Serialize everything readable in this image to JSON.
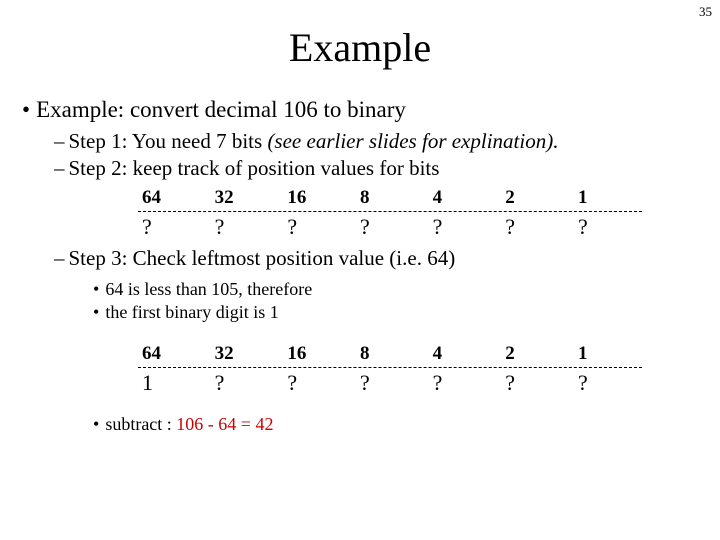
{
  "page_number": "35",
  "title": "Example",
  "bullet1": "Example: convert decimal 106 to binary",
  "step1_pre": "Step 1: You need 7 bits ",
  "step1_ital": "(see earlier slides for explination).",
  "step2": "Step 2: keep track of position values for bits",
  "columns": [
    "64",
    "32",
    "16",
    "8",
    "4",
    "2",
    "1"
  ],
  "row1_values": [
    "?",
    "?",
    "?",
    "?",
    "?",
    "?",
    "?"
  ],
  "step3": "Step 3: Check leftmost position value (i.e. 64)",
  "sub1": "64 is less than 105, therefore",
  "sub2": "the first binary digit is 1",
  "row2_values": [
    "1",
    "?",
    "?",
    "?",
    "?",
    "?",
    "?"
  ],
  "subtract_label": "subtract : ",
  "subtract_expr": "106 - 64 = 42"
}
